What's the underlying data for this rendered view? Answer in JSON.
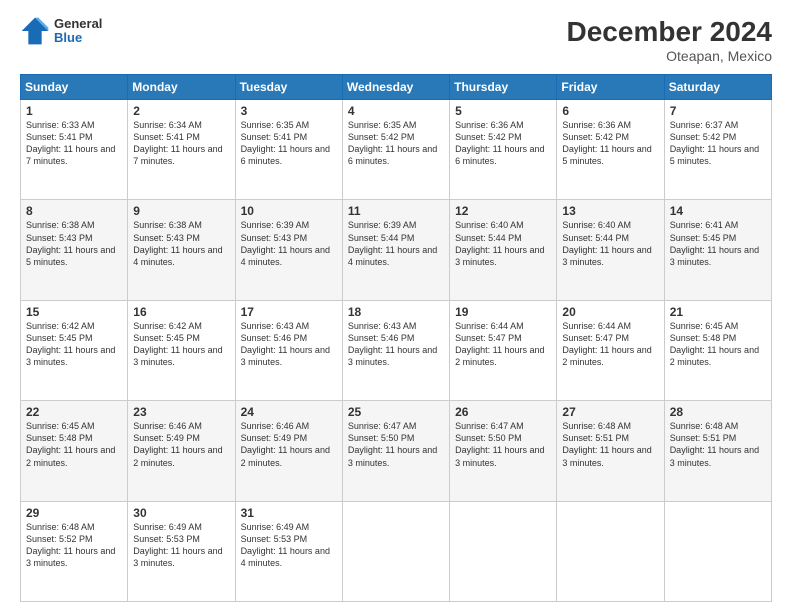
{
  "logo": {
    "line1": "General",
    "line2": "Blue"
  },
  "title": "December 2024",
  "subtitle": "Oteapan, Mexico",
  "weekdays": [
    "Sunday",
    "Monday",
    "Tuesday",
    "Wednesday",
    "Thursday",
    "Friday",
    "Saturday"
  ],
  "weeks": [
    [
      {
        "day": "1",
        "sunrise": "6:33 AM",
        "sunset": "5:41 PM",
        "daylight": "11 hours and 7 minutes."
      },
      {
        "day": "2",
        "sunrise": "6:34 AM",
        "sunset": "5:41 PM",
        "daylight": "11 hours and 7 minutes."
      },
      {
        "day": "3",
        "sunrise": "6:35 AM",
        "sunset": "5:41 PM",
        "daylight": "11 hours and 6 minutes."
      },
      {
        "day": "4",
        "sunrise": "6:35 AM",
        "sunset": "5:42 PM",
        "daylight": "11 hours and 6 minutes."
      },
      {
        "day": "5",
        "sunrise": "6:36 AM",
        "sunset": "5:42 PM",
        "daylight": "11 hours and 6 minutes."
      },
      {
        "day": "6",
        "sunrise": "6:36 AM",
        "sunset": "5:42 PM",
        "daylight": "11 hours and 5 minutes."
      },
      {
        "day": "7",
        "sunrise": "6:37 AM",
        "sunset": "5:42 PM",
        "daylight": "11 hours and 5 minutes."
      }
    ],
    [
      {
        "day": "8",
        "sunrise": "6:38 AM",
        "sunset": "5:43 PM",
        "daylight": "11 hours and 5 minutes."
      },
      {
        "day": "9",
        "sunrise": "6:38 AM",
        "sunset": "5:43 PM",
        "daylight": "11 hours and 4 minutes."
      },
      {
        "day": "10",
        "sunrise": "6:39 AM",
        "sunset": "5:43 PM",
        "daylight": "11 hours and 4 minutes."
      },
      {
        "day": "11",
        "sunrise": "6:39 AM",
        "sunset": "5:44 PM",
        "daylight": "11 hours and 4 minutes."
      },
      {
        "day": "12",
        "sunrise": "6:40 AM",
        "sunset": "5:44 PM",
        "daylight": "11 hours and 3 minutes."
      },
      {
        "day": "13",
        "sunrise": "6:40 AM",
        "sunset": "5:44 PM",
        "daylight": "11 hours and 3 minutes."
      },
      {
        "day": "14",
        "sunrise": "6:41 AM",
        "sunset": "5:45 PM",
        "daylight": "11 hours and 3 minutes."
      }
    ],
    [
      {
        "day": "15",
        "sunrise": "6:42 AM",
        "sunset": "5:45 PM",
        "daylight": "11 hours and 3 minutes."
      },
      {
        "day": "16",
        "sunrise": "6:42 AM",
        "sunset": "5:45 PM",
        "daylight": "11 hours and 3 minutes."
      },
      {
        "day": "17",
        "sunrise": "6:43 AM",
        "sunset": "5:46 PM",
        "daylight": "11 hours and 3 minutes."
      },
      {
        "day": "18",
        "sunrise": "6:43 AM",
        "sunset": "5:46 PM",
        "daylight": "11 hours and 3 minutes."
      },
      {
        "day": "19",
        "sunrise": "6:44 AM",
        "sunset": "5:47 PM",
        "daylight": "11 hours and 2 minutes."
      },
      {
        "day": "20",
        "sunrise": "6:44 AM",
        "sunset": "5:47 PM",
        "daylight": "11 hours and 2 minutes."
      },
      {
        "day": "21",
        "sunrise": "6:45 AM",
        "sunset": "5:48 PM",
        "daylight": "11 hours and 2 minutes."
      }
    ],
    [
      {
        "day": "22",
        "sunrise": "6:45 AM",
        "sunset": "5:48 PM",
        "daylight": "11 hours and 2 minutes."
      },
      {
        "day": "23",
        "sunrise": "6:46 AM",
        "sunset": "5:49 PM",
        "daylight": "11 hours and 2 minutes."
      },
      {
        "day": "24",
        "sunrise": "6:46 AM",
        "sunset": "5:49 PM",
        "daylight": "11 hours and 2 minutes."
      },
      {
        "day": "25",
        "sunrise": "6:47 AM",
        "sunset": "5:50 PM",
        "daylight": "11 hours and 3 minutes."
      },
      {
        "day": "26",
        "sunrise": "6:47 AM",
        "sunset": "5:50 PM",
        "daylight": "11 hours and 3 minutes."
      },
      {
        "day": "27",
        "sunrise": "6:48 AM",
        "sunset": "5:51 PM",
        "daylight": "11 hours and 3 minutes."
      },
      {
        "day": "28",
        "sunrise": "6:48 AM",
        "sunset": "5:51 PM",
        "daylight": "11 hours and 3 minutes."
      }
    ],
    [
      {
        "day": "29",
        "sunrise": "6:48 AM",
        "sunset": "5:52 PM",
        "daylight": "11 hours and 3 minutes."
      },
      {
        "day": "30",
        "sunrise": "6:49 AM",
        "sunset": "5:53 PM",
        "daylight": "11 hours and 3 minutes."
      },
      {
        "day": "31",
        "sunrise": "6:49 AM",
        "sunset": "5:53 PM",
        "daylight": "11 hours and 4 minutes."
      },
      null,
      null,
      null,
      null
    ]
  ]
}
